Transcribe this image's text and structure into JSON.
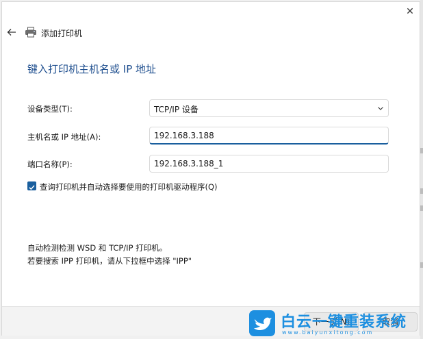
{
  "window": {
    "title": "添加打印机",
    "close_glyph": "✕"
  },
  "icons": {
    "back": "arrow-left-icon",
    "printer": "printer-icon",
    "close": "close-icon",
    "dropdown": "chevron-down-icon",
    "checkbox": "checkmark-icon"
  },
  "page": {
    "heading": "键入打印机主机名或 IP 地址"
  },
  "form": {
    "device_type": {
      "label": "设备类型(T):",
      "value": "TCP/IP 设备"
    },
    "hostname": {
      "label": "主机名或 IP 地址(A):",
      "value": "192.168.3.188"
    },
    "port_name": {
      "label": "端口名称(P):",
      "value": "192.168.3.188_1"
    },
    "auto_driver": {
      "label": "查询打印机并自动选择要使用的打印机驱动程序(Q)",
      "checked": true
    }
  },
  "info": {
    "line1": "自动检测检测 WSD 和 TCP/IP 打印机。",
    "line2": "若要搜索 IPP 打印机，请从下拉框中选择 \"IPP\""
  },
  "buttons": {
    "next": "下一页(N)",
    "cancel": "取消"
  },
  "watermark": {
    "main": "白云一键重装系统",
    "sub": "www.baiyunxitong.com"
  },
  "colors": {
    "accent": "#1a5f9e",
    "heading": "#1f4f8f",
    "watermark": "#1d8fe0"
  }
}
